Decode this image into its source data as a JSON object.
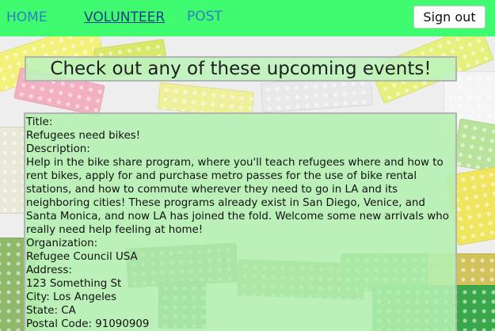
{
  "nav": {
    "home": "HOME",
    "volunteer": "VOLUNTEER",
    "post": "POST",
    "signout": "Sign out"
  },
  "heading": "Check out any of these upcoming events!",
  "event": {
    "title_label": "Title:",
    "title": "Refugees need bikes!",
    "description_label": "Description:",
    "description": "Help in the bike share program, where you'll teach refugees where and how to rent bikes, apply for and purchase metro passes for the use of bike rental stations, and how to commute wherever they need to go in LA and its neighboring cities! These programs already exist in San Diego, Venice, and Santa Monica, and now LA has joined the fold. Welcome some new arrivals who really need help feeling at home!",
    "organization_label": "Organization:",
    "organization": "Refugee Council USA",
    "address_label": "Address:",
    "address": "123 Something St",
    "city": "City: Los Angeles",
    "state": "State: CA",
    "postal_code": "Postal Code: 91090909"
  },
  "colors": {
    "navbar": "#3ffb6f",
    "nav_link": "#2e7fc4",
    "nav_link_active": "#1d3f8a",
    "panel": "#b4f0b2",
    "panel_border": "#b3b3b3"
  },
  "background_image": "lego-bricks-pattern"
}
